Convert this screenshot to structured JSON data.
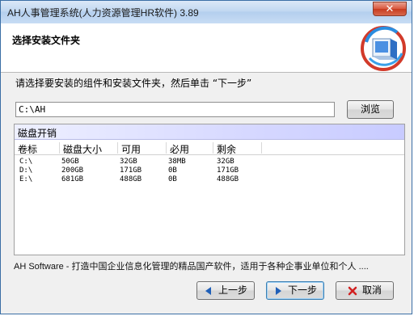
{
  "window": {
    "title": "AH人事管理系统(人力资源管理HR软件) 3.89",
    "close_glyph": "✕"
  },
  "header": {
    "title": "选择安装文件夹"
  },
  "instruction": "请选择要安装的组件和安装文件夹，然后单击 “下一步”",
  "install_path": {
    "value": "C:\\AH",
    "browse_label": "浏览"
  },
  "disk_space": {
    "title": "磁盘开销",
    "columns": [
      "卷标",
      "磁盘大小",
      "可用",
      "必用",
      "剩余"
    ],
    "rows": [
      [
        "C:\\",
        "50GB",
        "32GB",
        "38MB",
        "32GB"
      ],
      [
        "D:\\",
        "200GB",
        "171GB",
        "0B",
        "171GB"
      ],
      [
        "E:\\",
        "681GB",
        "488GB",
        "0B",
        "488GB"
      ]
    ]
  },
  "footer": {
    "brand_text": "AH Software - 打造中国企业信息化管理的精品国产软件，适用于各种企事业单位和个人 ...."
  },
  "buttons": {
    "prev_label": "上一步",
    "next_label": "下一步",
    "cancel_label": "取消"
  },
  "icons": {
    "prev": "arrow-left-icon",
    "next": "arrow-right-icon",
    "cancel": "red-x-icon",
    "logo": "installer-logo-icon"
  },
  "colors": {
    "title_bar": "#c2d8f1",
    "disk_title_band": "#c8cbff",
    "close_button": "#c73b1f",
    "arrow_blue": "#1f5fb8",
    "cancel_red": "#d22020"
  }
}
